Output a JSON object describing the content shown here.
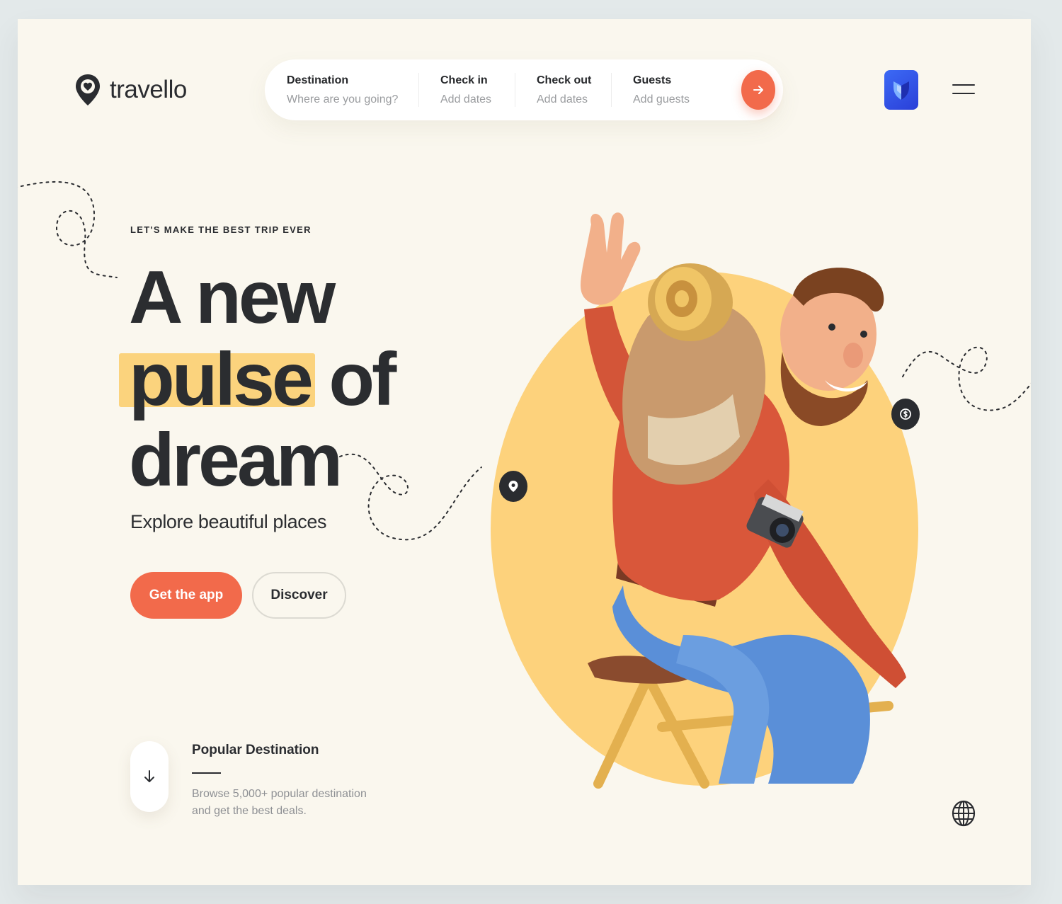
{
  "brand": {
    "name": "travello"
  },
  "search": {
    "fields": [
      {
        "label": "Destination",
        "value": "Where are you going?"
      },
      {
        "label": "Check in",
        "value": "Add dates"
      },
      {
        "label": "Check out",
        "value": "Add dates"
      },
      {
        "label": "Guests",
        "value": "Add guests"
      }
    ],
    "submit_icon": "arrow-right-icon"
  },
  "header": {
    "app_icon": "shield-logo-icon",
    "menu_icon": "hamburger-menu-icon"
  },
  "hero": {
    "kicker": "LET'S MAKE THE BEST TRIP EVER",
    "line1": "A new",
    "line2_highlight": "pulse",
    "line2_rest": "of",
    "line3": "dream",
    "subtitle": "Explore beautiful places",
    "primary_button": "Get the app",
    "secondary_button": "Discover"
  },
  "popular": {
    "title": "Popular Destination",
    "description": "Browse 5,000+ popular destination and get the best deals.",
    "scroll_icon": "arrow-down-icon"
  },
  "footer": {
    "globe_icon": "globe-icon"
  },
  "colors": {
    "accent": "#f26a4b",
    "highlight": "#fbd37d",
    "circle": "#fdd27c",
    "background": "#faf7ee",
    "text": "#2b2d30"
  }
}
